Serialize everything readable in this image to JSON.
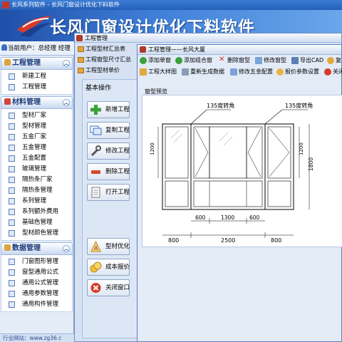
{
  "app": {
    "title": "长风系列软件 - 长风门窗设计优化下料软件",
    "banner_title": "长风门窗设计优化下料软件"
  },
  "user_bar": {
    "text": "当前用户：总经理 经理"
  },
  "sidebar": {
    "groups": [
      {
        "title": "工程管理",
        "icon": "project-icon",
        "items": [
          "新建工程",
          "工程管理"
        ]
      },
      {
        "title": "材料管理",
        "icon": "material-icon",
        "items": [
          "型材厂家",
          "型材管理",
          "五金厂家",
          "五金管理",
          "五金配置",
          "玻璃管理",
          "隔热条厂家",
          "隔热条管理",
          "系列管理",
          "系列额外费用",
          "基础色管理",
          "型材颜色管理"
        ]
      },
      {
        "title": "数据管理",
        "icon": "data-icon",
        "items": [
          "门窗图形管理",
          "窗型通用公式",
          "通用公式管理",
          "通用参数管理",
          "通用构件管理"
        ]
      }
    ],
    "status": "行业网站：www.zg36.c"
  },
  "mdi_back": {
    "title": "工程管理",
    "toolbar": [
      "工程型材汇总表",
      "工程窗型尺寸汇总",
      "工程型材单价"
    ],
    "ops_title": "基本操作",
    "buttons": [
      {
        "label": "新增工程",
        "icon": "plus-icon"
      },
      {
        "label": "复制工程",
        "icon": "copy-icon"
      },
      {
        "label": "修改工程",
        "icon": "wrench-icon"
      },
      {
        "label": "删除工程",
        "icon": "delete-icon"
      },
      {
        "label": "打开工程",
        "icon": "open-icon"
      },
      {
        "label": "型材优化",
        "icon": "optimize-icon"
      },
      {
        "label": "成本报价",
        "icon": "coins-icon"
      },
      {
        "label": "关闭窗口",
        "icon": "close-icon"
      }
    ]
  },
  "mdi_front": {
    "title": "工程管理——长风大厦",
    "row1": [
      "添加单窗",
      "添加组合窗",
      "删除窗型",
      "修改窗型",
      "导出CAD",
      "复"
    ],
    "row2": [
      "工程大样图",
      "重新生成数据",
      "修改五金配置",
      "报价参数设置",
      "关闭"
    ],
    "preview_label": "窗型预览",
    "drawing": {
      "corner_left": "135度转角",
      "corner_right": "135度转角",
      "dims_bottom_inner": [
        "600",
        "1300",
        "600"
      ],
      "dims_bottom_outer": [
        "800",
        "2500",
        "800"
      ],
      "dim_right_inner": "1200",
      "dim_right_outer": "1800",
      "dim_left_inner": "1200"
    }
  },
  "colors": {
    "banner": "#2f6bc7",
    "panel": "#e4ecf8",
    "window_border": "#5b80bd"
  }
}
